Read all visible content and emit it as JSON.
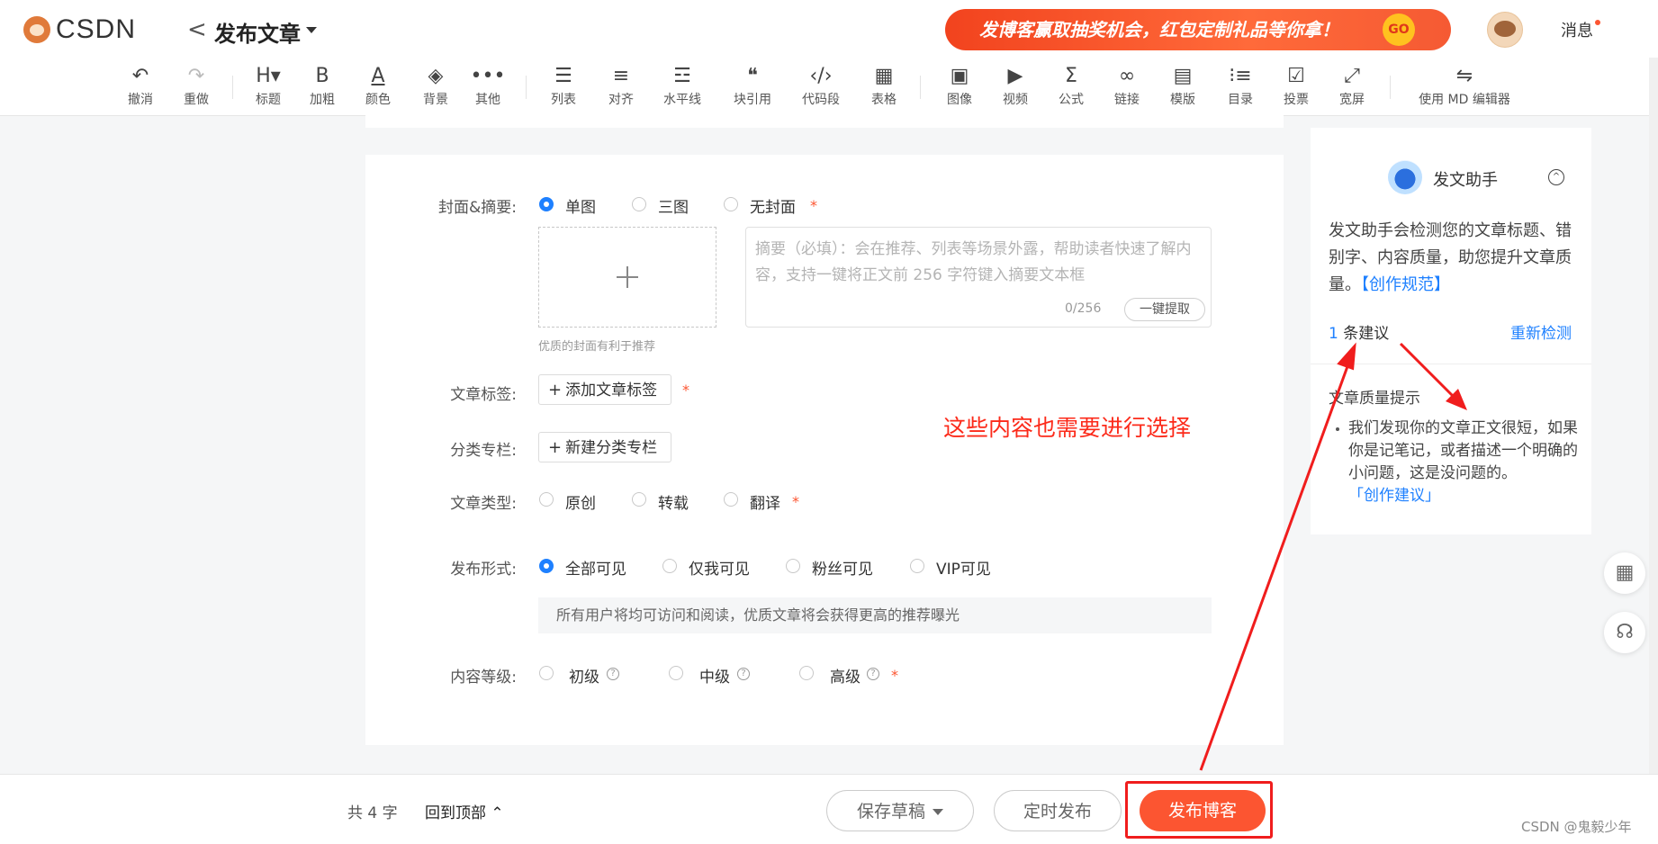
{
  "header": {
    "logo_text": "CSDN",
    "back_glyph": "<",
    "title": "发布文章",
    "banner": "发博客赢取抽奖机会，红包定制礼品等你拿！",
    "banner_go": "GO",
    "messages": "消息"
  },
  "toolbar": {
    "undo": "撤消",
    "redo": "重做",
    "heading": "标题",
    "bold": "加粗",
    "color": "颜色",
    "background": "背景",
    "more": "其他",
    "list": "列表",
    "align": "对齐",
    "hr": "水平线",
    "quote": "块引用",
    "code": "代码段",
    "table": "表格",
    "image": "图像",
    "video": "视频",
    "formula": "公式",
    "link": "链接",
    "template": "模版",
    "toc": "目录",
    "vote": "投票",
    "wide": "宽屏",
    "md_editor": "使用 MD 编辑器"
  },
  "form": {
    "cover_label": "封面&摘要:",
    "cover_options": [
      "单图",
      "三图",
      "无封面"
    ],
    "cover_selected": "单图",
    "cover_hint": "优质的封面有利于推荐",
    "abstract_placeholder": "摘要（必填）：会在推荐、列表等场景外露，帮助读者快速了解内容，支持一键将正文前 256 字符键入摘要文本框",
    "abstract_count": "0/256",
    "extract_button": "一键提取",
    "tags_label": "文章标签:",
    "add_tag": "添加文章标签",
    "column_label": "分类专栏:",
    "new_column": "新建分类专栏",
    "type_label": "文章类型:",
    "type_options": [
      "原创",
      "转载",
      "翻译"
    ],
    "visibility_label": "发布形式:",
    "visibility_options": [
      "全部可见",
      "仅我可见",
      "粉丝可见",
      "VIP可见"
    ],
    "visibility_selected": "全部可见",
    "visibility_desc": "所有用户将均可访问和阅读，优质文章将会获得更高的推荐曝光",
    "level_label": "内容等级:",
    "level_options": [
      "初级",
      "中级",
      "高级"
    ],
    "required_mark": "*",
    "plus": "+",
    "help_glyph": "?"
  },
  "annotation": {
    "note": "这些内容也需要进行选择",
    "color": "#f01d1d"
  },
  "assistant": {
    "title": "发文助手",
    "collapse_glyph": "^",
    "desc": "发文助手会检测您的文章标题、错别字、内容质量，助您提升文章质量。",
    "rules_link": "【创作规范】",
    "suggestion_count": "1",
    "suggestion_text": "条建议",
    "recheck": "重新检测",
    "quality_title": "文章质量提示",
    "quality_tip": "我们发现你的文章正文很短，如果你是记笔记，或者描述一个明确的小问题，这是没问题的。",
    "quality_link": "「创作建议」"
  },
  "bottom": {
    "word_count": "共 4 字",
    "back_to_top": "回到顶部",
    "save_draft": "保存草稿",
    "timed_publish": "定时发布",
    "publish": "发布博客",
    "watermark": "CSDN @鬼毅少年"
  },
  "colors": {
    "accent": "#fc5531",
    "link": "#1e80ff"
  }
}
